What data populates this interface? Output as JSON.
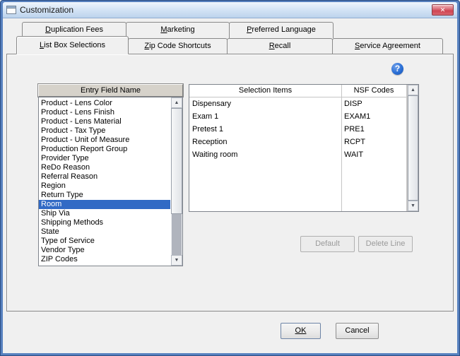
{
  "window": {
    "title": "Customization"
  },
  "icons": {
    "close_glyph": "✕",
    "help_glyph": "?",
    "arrow_up": "▲",
    "arrow_down": "▼"
  },
  "colors": {
    "frame_blue": "#5781bf",
    "selection_bg": "#316ac5",
    "help_blue": "#2a6fd6",
    "close_red": "#cf4552",
    "panel_gray": "#f0f0f0"
  },
  "tabs": {
    "row1": [
      {
        "u": "D",
        "rest": "uplication Fees"
      },
      {
        "u": "M",
        "rest": "arketing"
      },
      {
        "u": "P",
        "rest": "referred Language"
      }
    ],
    "row2": [
      {
        "u": "L",
        "rest": "ist Box Selections"
      },
      {
        "u": "Z",
        "rest": "ip Code Shortcuts"
      },
      {
        "u": "R",
        "rest": "ecall"
      },
      {
        "u": "S",
        "rest": "ervice Agreement"
      }
    ],
    "active": "List Box Selections"
  },
  "listbox": {
    "header": "Entry Field Name",
    "selected": "Room",
    "items": [
      "Product - Lens Color",
      "Product - Lens Finish",
      "Product - Lens Material",
      "Product - Tax Type",
      "Product - Unit of Measure",
      "Production Report Group",
      "Provider Type",
      "ReDo Reason",
      "Referral Reason",
      "Region",
      "Return Type",
      "Room",
      "Ship Via",
      "Shipping Methods",
      "State",
      "Type of Service",
      "Vendor Type",
      "ZIP Codes"
    ]
  },
  "table": {
    "headers": [
      "Selection Items",
      "NSF Codes"
    ],
    "rows": [
      {
        "item": "Dispensary",
        "code": "DISP"
      },
      {
        "item": "Exam 1",
        "code": "EXAM1"
      },
      {
        "item": "Pretest 1",
        "code": "PRE1"
      },
      {
        "item": "Reception",
        "code": "RCPT"
      },
      {
        "item": "Waiting room",
        "code": "WAIT"
      }
    ]
  },
  "buttons": {
    "default": "Default",
    "delete_line": "Delete Line",
    "ok": "OK",
    "cancel": "Cancel"
  }
}
